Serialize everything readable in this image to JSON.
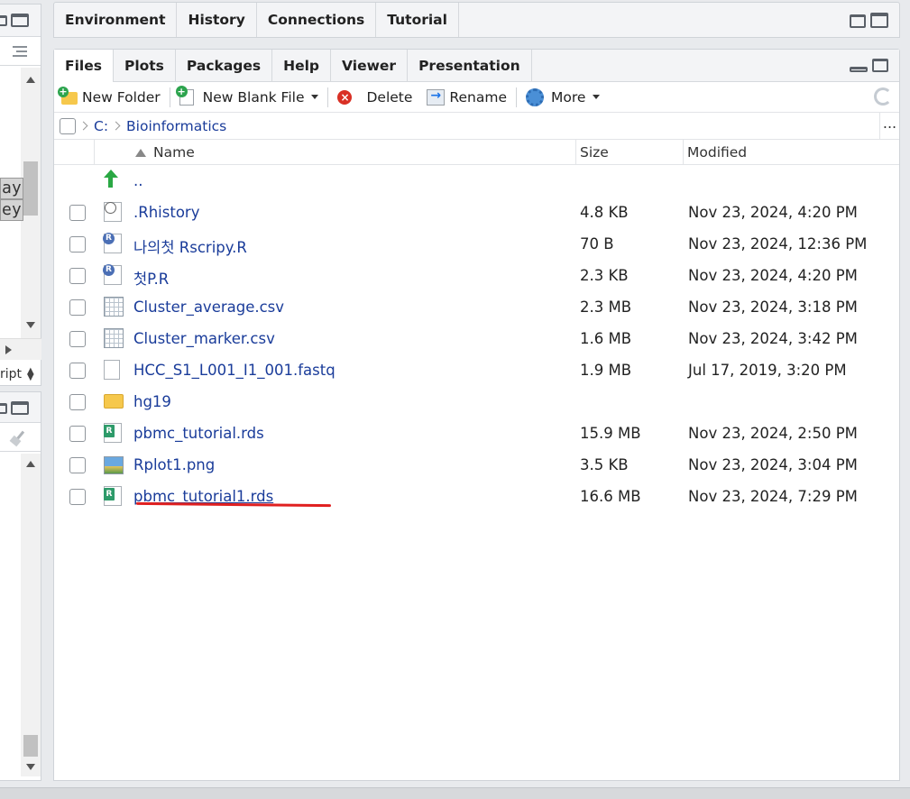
{
  "left_pane": {
    "code_lines": [
      "ay",
      "ey"
    ],
    "script_label": "ript"
  },
  "top_pane": {
    "tabs": [
      {
        "label": "Environment",
        "active": false
      },
      {
        "label": "History",
        "active": false
      },
      {
        "label": "Connections",
        "active": false
      },
      {
        "label": "Tutorial",
        "active": false
      }
    ]
  },
  "files_pane": {
    "tabs": [
      {
        "label": "Files",
        "active": true
      },
      {
        "label": "Plots",
        "active": false
      },
      {
        "label": "Packages",
        "active": false
      },
      {
        "label": "Help",
        "active": false
      },
      {
        "label": "Viewer",
        "active": false
      },
      {
        "label": "Presentation",
        "active": false
      }
    ],
    "toolbar": {
      "new_folder": "New Folder",
      "new_blank_file": "New Blank File",
      "delete": "Delete",
      "rename": "Rename",
      "more": "More"
    },
    "breadcrumb": {
      "root": "C:",
      "current": "Bioinformatics",
      "more": "..."
    },
    "columns": {
      "name": "Name",
      "size": "Size",
      "modified": "Modified"
    },
    "parent_dir": "..",
    "files": [
      {
        "name": ".Rhistory",
        "size": "4.8 KB",
        "modified": "Nov 23, 2024, 4:20 PM",
        "icon": "history-file-icon"
      },
      {
        "name": "나의첫 Rscripy.R",
        "size": "70 B",
        "modified": "Nov 23, 2024, 12:36 PM",
        "icon": "r-script-icon"
      },
      {
        "name": "첫P.R",
        "size": "2.3 KB",
        "modified": "Nov 23, 2024, 4:20 PM",
        "icon": "r-script-icon"
      },
      {
        "name": "Cluster_average.csv",
        "size": "2.3 MB",
        "modified": "Nov 23, 2024, 3:18 PM",
        "icon": "csv-file-icon"
      },
      {
        "name": "Cluster_marker.csv",
        "size": "1.6 MB",
        "modified": "Nov 23, 2024, 3:42 PM",
        "icon": "csv-file-icon"
      },
      {
        "name": "HCC_S1_L001_I1_001.fastq",
        "size": "1.9 MB",
        "modified": "Jul 17, 2019, 3:20 PM",
        "icon": "blank-file-icon"
      },
      {
        "name": "hg19",
        "size": "",
        "modified": "",
        "icon": "folder-icon"
      },
      {
        "name": "pbmc_tutorial.rds",
        "size": "15.9 MB",
        "modified": "Nov 23, 2024, 2:50 PM",
        "icon": "rds-file-icon"
      },
      {
        "name": "Rplot1.png",
        "size": "3.5 KB",
        "modified": "Nov 23, 2024, 3:04 PM",
        "icon": "image-file-icon"
      },
      {
        "name": "pbmc_tutorial1.rds",
        "size": "16.6 MB",
        "modified": "Nov 23, 2024, 7:29 PM",
        "icon": "rds-file-icon"
      }
    ]
  },
  "colors": {
    "link": "#1a3c9a",
    "highlight_underline": "#e02020",
    "pane_header": "#f3f4f6"
  }
}
